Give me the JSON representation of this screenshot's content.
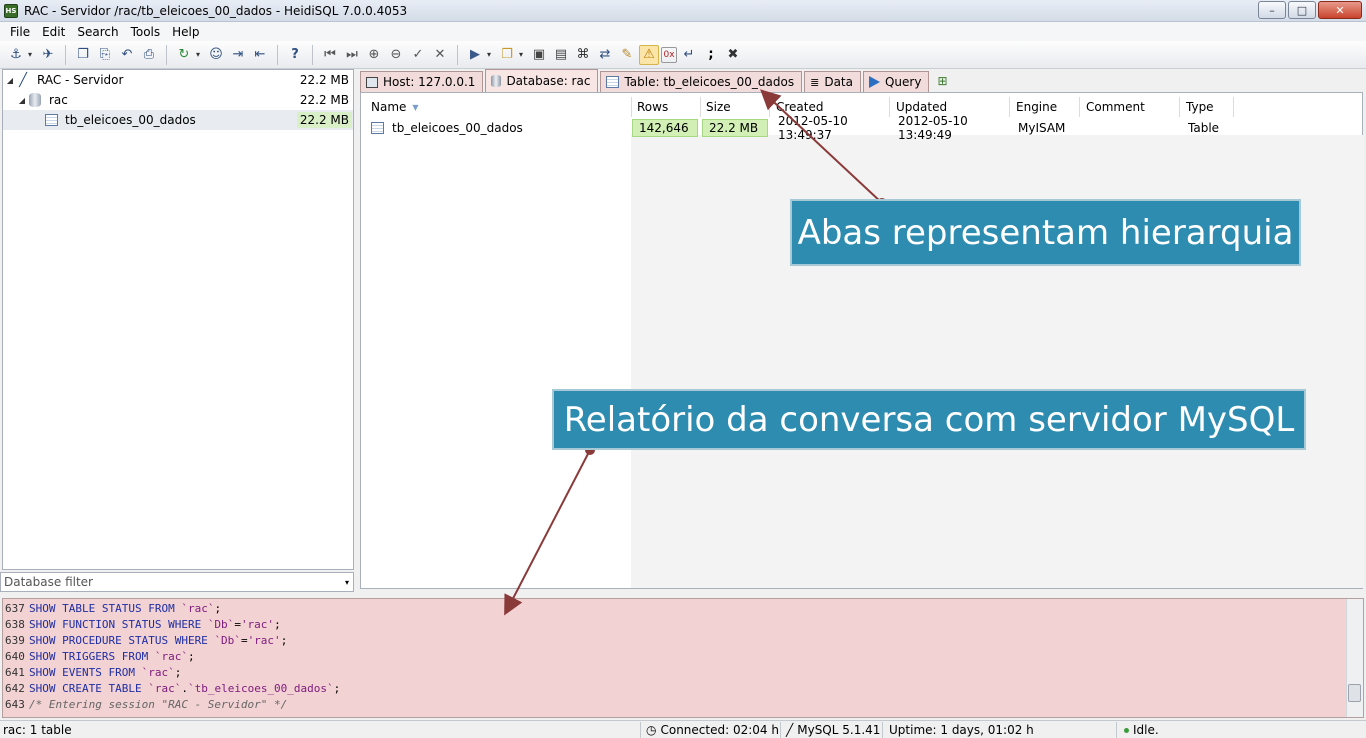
{
  "window": {
    "title": "RAC - Servidor /rac/tb_eleicoes_00_dados - HeidiSQL 7.0.0.4053",
    "logo": "HS",
    "minimize_glyph": "–",
    "maximize_glyph": "□",
    "close_glyph": "✕"
  },
  "menu": [
    "File",
    "Edit",
    "Search",
    "Tools",
    "Help"
  ],
  "toolbar": {
    "icons": [
      "connect-icon",
      "disconnect-icon",
      "copy-icon",
      "paste-icon",
      "undo-icon",
      "print-icon",
      "refresh-icon",
      "user-manager-icon",
      "export-icon",
      "import-icon",
      "help-icon",
      "first-icon",
      "last-icon",
      "insert-icon",
      "delete-icon",
      "post-icon",
      "cancel-icon",
      "run-icon",
      "open-file-icon",
      "save-icon",
      "save-as-icon",
      "search-icon",
      "replace-icon",
      "edit-icon",
      "warning-icon",
      "hex-icon",
      "wrap-icon",
      "semicolon-icon",
      "stop-icon"
    ],
    "glyphs": {
      "connect": "⚓",
      "disconnect": "✈",
      "copy": "❐",
      "paste": "⎘",
      "undo": "↶",
      "print": "⎙",
      "refresh": "↻",
      "users": "☺",
      "export": "⇥",
      "import": "⇤",
      "help": "?",
      "first": "⏮",
      "last": "⏭",
      "insert": "⊕",
      "delete": "⊖",
      "post": "✓",
      "cancel": "✕",
      "run": "▶",
      "open": "❐",
      "save": "▣",
      "saveas": "▤",
      "find": "⌘",
      "replace": "⇄",
      "edit": "✎",
      "warning": "⚠",
      "hex": "0x",
      "wrap": "↵",
      "semicolon": ";",
      "stop": "✖",
      "dropdown": "▾"
    }
  },
  "tree": {
    "rows": [
      {
        "label": "RAC - Servidor",
        "size": "22.2 MB",
        "arrow": "◢"
      },
      {
        "label": "rac",
        "size": "22.2 MB",
        "arrow": "◢"
      },
      {
        "label": "tb_eleicoes_00_dados",
        "size": "22.2 MB"
      }
    ],
    "host_glyph": "╱",
    "filter_placeholder": "Database filter",
    "filter_dropdown": "▾"
  },
  "tabs": [
    {
      "label": "Host: 127.0.0.1"
    },
    {
      "label": "Database: rac"
    },
    {
      "label": "Table: tb_eleicoes_00_dados"
    },
    {
      "label": "Data",
      "glyph": "≣"
    },
    {
      "label": "Query"
    }
  ],
  "tab_add_glyph": "⊞",
  "table": {
    "columns": [
      "Name",
      "Rows",
      "Size",
      "Created",
      "Updated",
      "Engine",
      "Comment",
      "Type"
    ],
    "sort_glyph": "▼",
    "rows": [
      {
        "name": "tb_eleicoes_00_dados",
        "rows": "142,646",
        "size": "22.2 MB",
        "created": "2012-05-10 13:49:37",
        "updated": "2012-05-10 13:49:49",
        "engine": "MyISAM",
        "comment": "",
        "type": "Table"
      }
    ]
  },
  "log": [
    {
      "n": "637",
      "parts": [
        [
          "kw",
          "SHOW TABLE STATUS FROM "
        ],
        [
          "str",
          "`rac`"
        ],
        [
          "",
          ";"
        ]
      ]
    },
    {
      "n": "638",
      "parts": [
        [
          "kw",
          "SHOW FUNCTION STATUS WHERE "
        ],
        [
          "str",
          "`Db`"
        ],
        [
          "",
          "="
        ],
        [
          "str",
          "'rac'"
        ],
        [
          "",
          ";"
        ]
      ]
    },
    {
      "n": "639",
      "parts": [
        [
          "kw",
          "SHOW PROCEDURE STATUS WHERE "
        ],
        [
          "str",
          "`Db`"
        ],
        [
          "",
          "="
        ],
        [
          "str",
          "'rac'"
        ],
        [
          "",
          ";"
        ]
      ]
    },
    {
      "n": "640",
      "parts": [
        [
          "kw",
          "SHOW TRIGGERS FROM "
        ],
        [
          "str",
          "`rac`"
        ],
        [
          "",
          ";"
        ]
      ]
    },
    {
      "n": "641",
      "parts": [
        [
          "kw",
          "SHOW EVENTS FROM "
        ],
        [
          "str",
          "`rac`"
        ],
        [
          "",
          ";"
        ]
      ]
    },
    {
      "n": "642",
      "parts": [
        [
          "kw",
          "SHOW CREATE TABLE "
        ],
        [
          "str",
          "`rac`"
        ],
        [
          "",
          "."
        ],
        [
          "str",
          "`tb_eleicoes_00_dados`"
        ],
        [
          "",
          ";"
        ]
      ]
    },
    {
      "n": "643",
      "parts": [
        [
          "cmt",
          "/* Entering session \"RAC - Servidor\" */"
        ]
      ]
    }
  ],
  "status": {
    "left": "rac: 1 table",
    "connected": "Connected: 02:04 h",
    "connected_glyph": "◷",
    "mysql": "MySQL 5.1.41",
    "mysql_glyph": "╱",
    "uptime": "Uptime: 1 days, 01:02 h",
    "idle": "Idle."
  },
  "annotations": {
    "tabs_note": "Abas representam hierarquia",
    "log_note": "Relatório da conversa com servidor MySQL"
  }
}
